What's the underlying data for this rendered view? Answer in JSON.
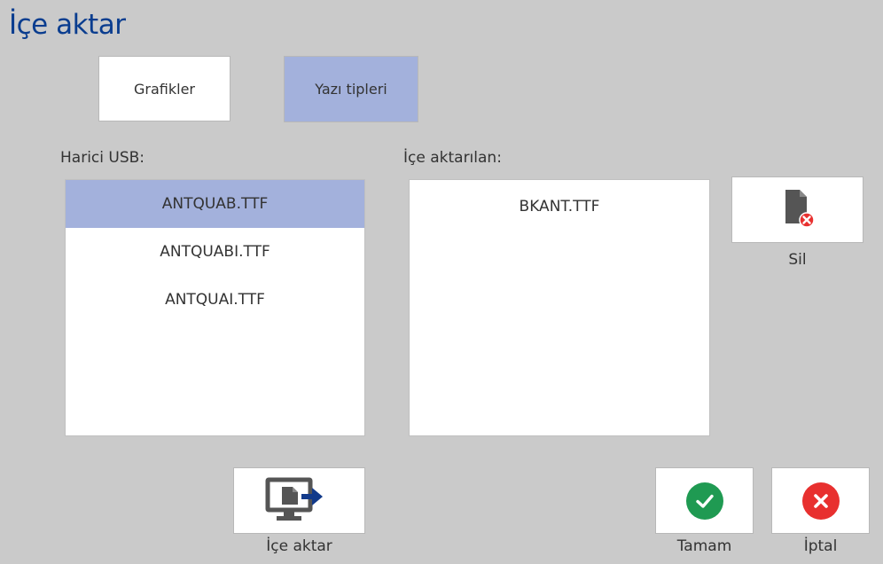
{
  "header": {
    "title": "İçe aktar"
  },
  "tabs": [
    {
      "label": "Grafikler",
      "selected": false
    },
    {
      "label": "Yazı tipleri",
      "selected": true
    }
  ],
  "usb_list": {
    "label": "Harici USB:",
    "items": [
      {
        "name": "ANTQUAB.TTF",
        "selected": true
      },
      {
        "name": "ANTQUABI.TTF",
        "selected": false
      },
      {
        "name": "ANTQUAI.TTF",
        "selected": false
      }
    ]
  },
  "imported_list": {
    "label": "İçe aktarılan:",
    "items": [
      {
        "name": "BKANT.TTF"
      }
    ]
  },
  "buttons": {
    "delete_label": "Sil",
    "import_label": "İçe aktar",
    "ok_label": "Tamam",
    "cancel_label": "İptal"
  },
  "colors": {
    "title": "#0a3d8f",
    "selection": "#a3b1dc",
    "ok": "#1f9a52",
    "cancel": "#e8302f",
    "icon": "#555555",
    "arrow": "#123a8a"
  }
}
